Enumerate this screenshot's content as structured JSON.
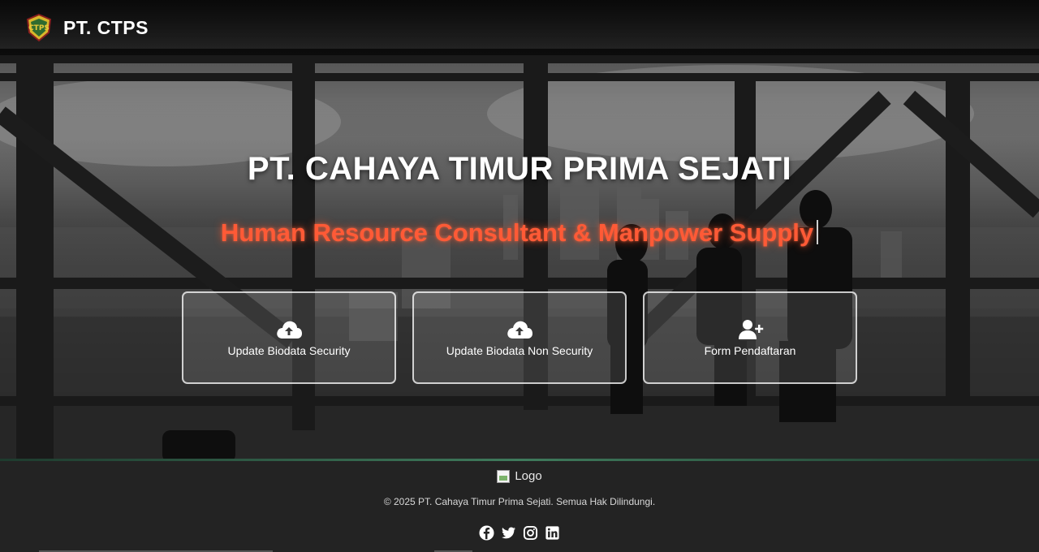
{
  "header": {
    "brand_name": "PT. CTPS",
    "logo_icon": "ctps-logo-icon"
  },
  "hero": {
    "title": "PT. CAHAYA TIMUR PRIMA SEJATI",
    "tagline": "Human Resource Consultant & Manpower Supply",
    "tagline_color": "#ff5a36"
  },
  "cards": [
    {
      "label": "Update Biodata Security",
      "icon": "cloud-upload-icon"
    },
    {
      "label": "Update Biodata Non Security",
      "icon": "cloud-upload-icon"
    },
    {
      "label": "Form Pendaftaran",
      "icon": "user-plus-icon"
    }
  ],
  "footer": {
    "logo_alt": "Logo",
    "copyright": "© 2025 PT. Cahaya Timur Prima Sejati. Semua Hak Dilindungi.",
    "socials": [
      "facebook-icon",
      "twitter-icon",
      "instagram-icon",
      "linkedin-icon"
    ]
  }
}
